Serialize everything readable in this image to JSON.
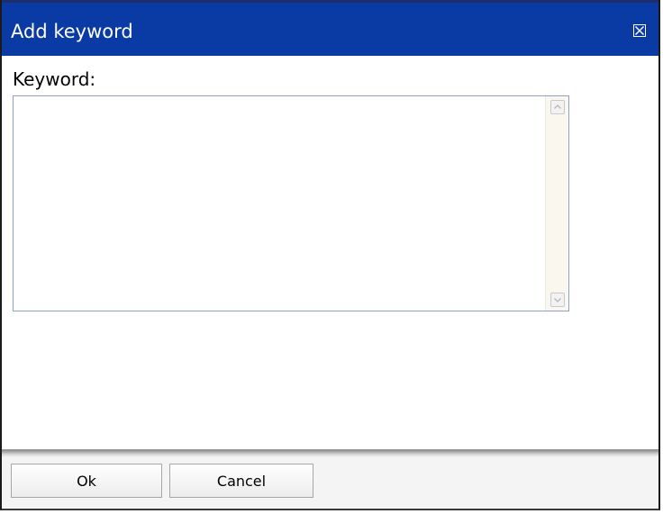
{
  "dialog": {
    "title": "Add keyword",
    "close_icon": "close-box-icon"
  },
  "form": {
    "keyword_label": "Keyword:",
    "keyword_value": ""
  },
  "buttons": {
    "ok_label": "Ok",
    "cancel_label": "Cancel"
  },
  "colors": {
    "titlebar": "#0a3aa3",
    "field_border": "#8ea2c6"
  }
}
